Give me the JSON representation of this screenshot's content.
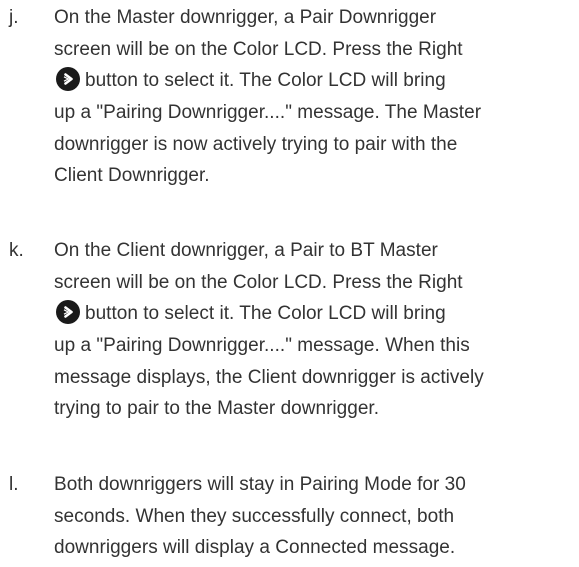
{
  "steps": [
    {
      "letter": "j.",
      "lines": [
        "On the Master downrigger, a Pair Downrigger",
        "screen will be on the Color LCD. Press the Right",
        "button to select it. The Color LCD will bring",
        "up a \"Pairing Downrigger....\" message. The Master",
        "downrigger is now actively trying to pair with the",
        "Client Downrigger."
      ],
      "icon": "right-arrow-button-icon"
    },
    {
      "letter": "k.",
      "lines": [
        "On the Client downrigger, a Pair to BT Master",
        "screen will be on the Color LCD. Press the Right",
        "button to select it. The Color LCD will bring",
        "up a \"Pairing Downrigger....\" message. When this",
        "message displays, the Client downrigger is actively",
        "trying to pair to the Master downrigger."
      ],
      "icon": "right-arrow-button-icon"
    },
    {
      "letter": "l.",
      "lines": [
        "Both downriggers will stay in Pairing Mode for 30",
        "seconds. When they successfully connect, both",
        "downriggers will display a Connected message."
      ]
    }
  ]
}
